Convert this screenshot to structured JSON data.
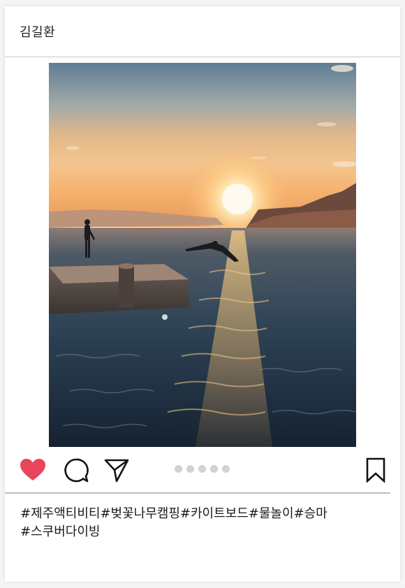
{
  "post": {
    "username": "김길환",
    "hashtags_line1": "#제주액티비티#벚꽃나무캠핑#카이트보드#물놀이#승마",
    "hashtags_line2": "#스쿠버다이빙"
  },
  "photo": {
    "subject": "sunset-sea-diving-photo"
  },
  "actions": {
    "like_icon": "heart-icon",
    "comment_icon": "comment-icon",
    "share_icon": "send-icon",
    "save_icon": "bookmark-icon",
    "carousel_dot_count": 5,
    "like_color": "#e8445a"
  },
  "colors": {
    "divider": "#bdbdbd",
    "dot": "#d2d2d2",
    "text": "#1a1a1a"
  }
}
